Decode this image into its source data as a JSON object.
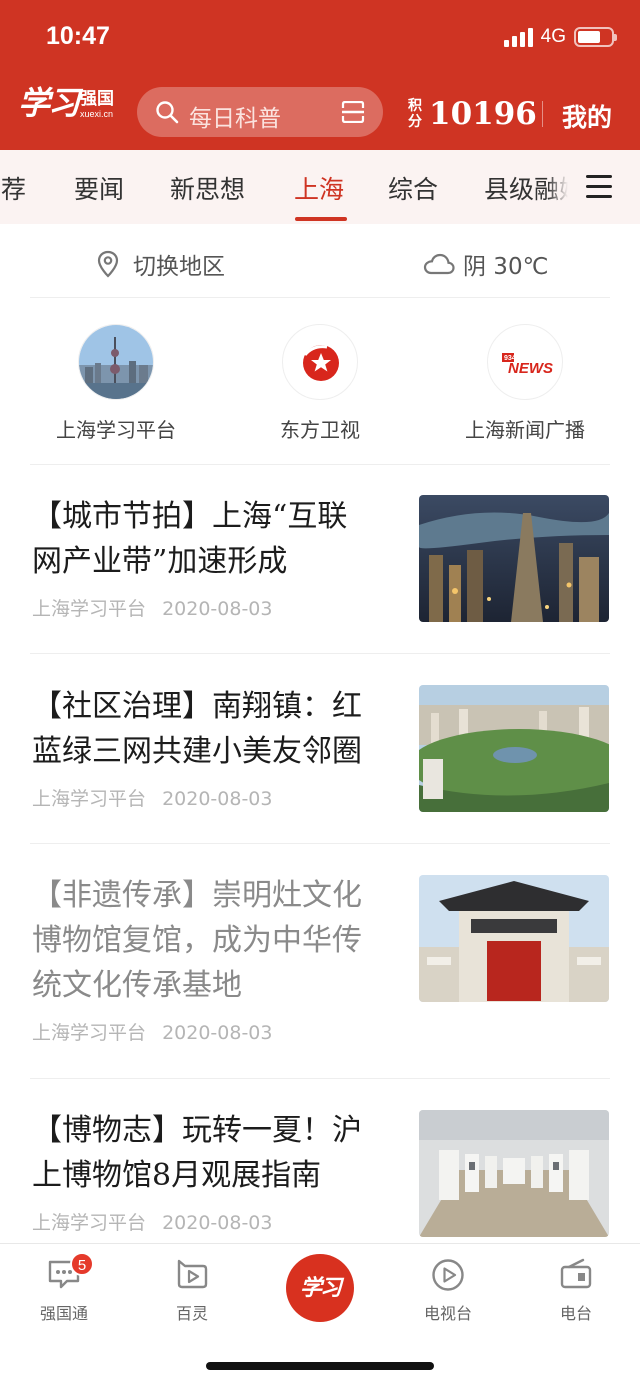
{
  "status_bar": {
    "time": "10:47",
    "network": "4G"
  },
  "header": {
    "logo_script": "学习",
    "logo_text": "强国",
    "logo_url": "xuexi.cn",
    "search_placeholder": "每日科普",
    "points_label_1": "积",
    "points_label_2": "分",
    "points_value": "10196",
    "mine_label": "我的"
  },
  "tabs": [
    {
      "label": "推荐"
    },
    {
      "label": "要闻"
    },
    {
      "label": "新思想"
    },
    {
      "label": "上海"
    },
    {
      "label": "综合"
    },
    {
      "label": "县级融媒"
    }
  ],
  "active_tab": "上海",
  "region": {
    "switch_label": "切换地区",
    "weather": "阴 30℃"
  },
  "channels": [
    {
      "label": "上海学习平台"
    },
    {
      "label": "东方卫视"
    },
    {
      "label": "上海新闻广播",
      "logo_text": "NEWS",
      "logo_num": "934"
    }
  ],
  "articles": [
    {
      "title": "【城市节拍】上海“互联网产业带”加速形成",
      "source": "上海学习平台",
      "date": "2020-08-03",
      "read": false
    },
    {
      "title": "【社区治理】南翔镇：红蓝绿三网共建小美友邻圈",
      "source": "上海学习平台",
      "date": "2020-08-03",
      "read": false
    },
    {
      "title": "【非遗传承】崇明灶文化博物馆复馆，成为中华传统文化传承基地",
      "source": "上海学习平台",
      "date": "2020-08-03",
      "read": true
    },
    {
      "title": "【博物志】玩转一夏！沪上博物馆8月观展指南",
      "source": "上海学习平台",
      "date": "2020-08-03",
      "read": false
    }
  ],
  "bottom_nav": [
    {
      "label": "强国通",
      "badge": "5"
    },
    {
      "label": "百灵"
    },
    {
      "label": "学习"
    },
    {
      "label": "电视台"
    },
    {
      "label": "电台"
    }
  ],
  "colors": {
    "brand_red": "#cf3423",
    "tab_bg": "#fbf3f2",
    "badge_red": "#e53a2b"
  }
}
